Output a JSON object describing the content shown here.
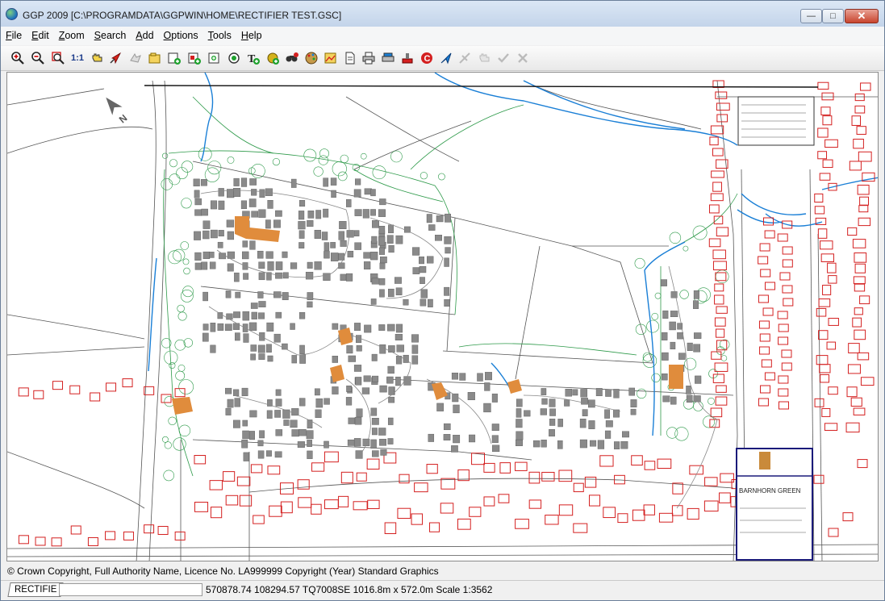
{
  "window": {
    "title": "GGP 2009 [C:\\PROGRAMDATA\\GGPWIN\\HOME\\RECTIFIER TEST.GSC]",
    "minimize_symbol": "—",
    "maximize_symbol": "□",
    "close_symbol": "✕"
  },
  "menu": {
    "items": [
      {
        "key": "F",
        "rest": "ile"
      },
      {
        "key": "E",
        "rest": "dit"
      },
      {
        "key": "Z",
        "rest": "oom"
      },
      {
        "key": "S",
        "rest": "earch"
      },
      {
        "key": "A",
        "rest": "dd"
      },
      {
        "key": "O",
        "rest": "ptions"
      },
      {
        "key": "T",
        "rest": "ools"
      },
      {
        "key": "H",
        "rest": "elp"
      }
    ]
  },
  "toolbar": {
    "scale_label": "1:1",
    "icons": [
      "zoom-in-icon",
      "zoom-out-icon",
      "zoom-window-icon",
      "scale-one-to-one-icon",
      "pan-hand-icon",
      "pointer-arrow-icon",
      "disabled-move-icon",
      "folder-open-icon",
      "add-layer-icon",
      "add-object-icon",
      "add-point-icon",
      "add-circle-icon",
      "add-text-icon",
      "globe-add-icon",
      "search-binoculars-icon",
      "palette-icon",
      "map-image-icon",
      "document-icon",
      "print-icon",
      "printer-setup-icon",
      "stamp-icon",
      "copyright-icon",
      "gps-arrow-icon",
      "disabled-tool-icon",
      "disabled-hand-icon",
      "disabled-check-icon",
      "disabled-cross-icon"
    ]
  },
  "map": {
    "north_label": "N",
    "inset_title": "BARNHORN GREEN",
    "colors": {
      "building_outline": "#d42020",
      "new_building_fill": "#8a8a8a",
      "highlight_fill": "#e08c3c",
      "water": "#1a7fd6",
      "vegetation": "#2e9a4a",
      "inset_border": "#1a1a7a"
    }
  },
  "copyright": "© Crown Copyright, Full Authority Name, Licence No. LA999999 Copyright (Year) Standard Graphics",
  "status": {
    "layer_tab": "RECTIFIE",
    "coordinates": "570878.74 108294.57 TQ7008SE 1016.8m x 572.0m Scale 1:3562"
  }
}
